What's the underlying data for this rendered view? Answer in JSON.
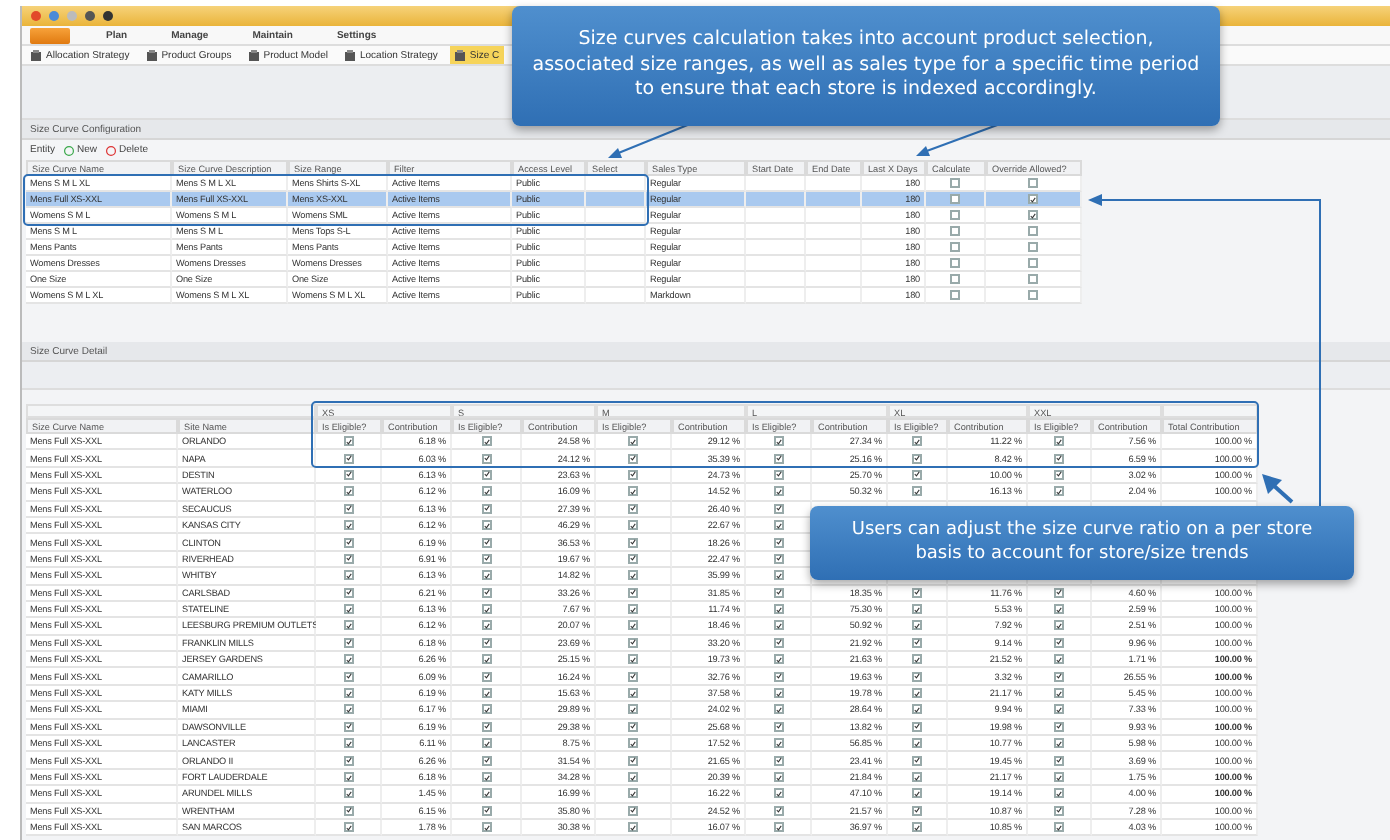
{
  "ribbon": {
    "tabs": [
      "Plan",
      "Manage",
      "Maintain",
      "Settings"
    ]
  },
  "toolbar": [
    {
      "label": "Allocation Strategy",
      "selected": false
    },
    {
      "label": "Product Groups",
      "selected": false
    },
    {
      "label": "Product Model",
      "selected": false
    },
    {
      "label": "Location Strategy",
      "selected": false
    },
    {
      "label": "Size C",
      "selected": true
    }
  ],
  "configuration": {
    "title": "Size Curve Configuration",
    "entity_label": "Entity",
    "actions": [
      {
        "kind": "new",
        "label": "New"
      },
      {
        "kind": "delete",
        "label": "Delete"
      }
    ],
    "columns": [
      "Size Curve Name",
      "Size Curve Description",
      "Size Range",
      "Filter",
      "Access Level",
      "Select",
      "Sales Type",
      "Start Date",
      "End Date",
      "Last X Days",
      "Calculate",
      "Override Allowed?"
    ],
    "rows": [
      {
        "name": "Mens S M L XL",
        "description": "Mens S M L XL",
        "size_range": "Mens Shirts S-XL",
        "filter": "Active Items",
        "access_level": "Public",
        "sales_type": "Regular",
        "last_x_days": "180",
        "calculate": false,
        "override_allowed": false,
        "selected": false
      },
      {
        "name": "Mens Full XS-XXL",
        "description": "Mens Full XS-XXL",
        "size_range": "Mens XS-XXL",
        "filter": "Active Items",
        "access_level": "Public",
        "sales_type": "Regular",
        "last_x_days": "180",
        "calculate": false,
        "override_allowed": true,
        "selected": true
      },
      {
        "name": "Womens S M L",
        "description": "Womens S M L",
        "size_range": "Womens SML",
        "filter": "Active Items",
        "access_level": "Public",
        "sales_type": "Regular",
        "last_x_days": "180",
        "calculate": false,
        "override_allowed": true,
        "selected": false
      },
      {
        "name": "Mens S M L",
        "description": "Mens S M L",
        "size_range": "Mens Tops S-L",
        "filter": "Active Items",
        "access_level": "Public",
        "sales_type": "Regular",
        "last_x_days": "180",
        "calculate": false,
        "override_allowed": false,
        "selected": false
      },
      {
        "name": "Mens Pants",
        "description": "Mens Pants",
        "size_range": "Mens Pants",
        "filter": "Active Items",
        "access_level": "Public",
        "sales_type": "Regular",
        "last_x_days": "180",
        "calculate": false,
        "override_allowed": false,
        "selected": false
      },
      {
        "name": "Womens Dresses",
        "description": "Womens Dresses",
        "size_range": "Womens Dresses",
        "filter": "Active Items",
        "access_level": "Public",
        "sales_type": "Regular",
        "last_x_days": "180",
        "calculate": false,
        "override_allowed": false,
        "selected": false
      },
      {
        "name": "One Size",
        "description": "One Size",
        "size_range": "One Size",
        "filter": "Active Items",
        "access_level": "Public",
        "sales_type": "Regular",
        "last_x_days": "180",
        "calculate": false,
        "override_allowed": false,
        "selected": false
      },
      {
        "name": "Womens S M L XL",
        "description": "Womens S M L XL",
        "size_range": "Womens S M L XL",
        "filter": "Active Items",
        "access_level": "Public",
        "sales_type": "Markdown",
        "last_x_days": "180",
        "calculate": false,
        "override_allowed": false,
        "selected": false
      }
    ]
  },
  "detail": {
    "title": "Size Curve Detail",
    "size_groups": [
      {
        "label": "XS",
        "eligible": "Is Eligible?",
        "contribution": "Contribution"
      },
      {
        "label": "S",
        "eligible": "Is Eligible?",
        "contribution": "Contribution"
      },
      {
        "label": "M",
        "eligible": "Is Eligible?",
        "contribution": "Contribution"
      },
      {
        "label": "L",
        "eligible": "Is Eligible?",
        "contribution": "Contribution"
      },
      {
        "label": "XL",
        "eligible": "Is Eligible?",
        "contribution": "Contribution"
      },
      {
        "label": "XXL",
        "eligible": "Is Eligible?",
        "contribution": "Contribution"
      }
    ],
    "columns": {
      "name": "Size Curve Name",
      "site": "Site Name",
      "total": "Total Contribution"
    },
    "rows": [
      {
        "name": "Mens Full XS-XXL",
        "site": "ORLANDO",
        "sizes": [
          {
            "eligible": true,
            "contribution": "6.18 %"
          },
          {
            "eligible": true,
            "contribution": "24.58 %"
          },
          {
            "eligible": true,
            "contribution": "29.12 %"
          },
          {
            "eligible": true,
            "contribution": "27.34 %"
          },
          {
            "eligible": true,
            "contribution": "11.22 %"
          },
          {
            "eligible": true,
            "contribution": "7.56 %"
          }
        ],
        "total": "100.00 %",
        "total_bold": false
      },
      {
        "name": "Mens Full XS-XXL",
        "site": "NAPA",
        "sizes": [
          {
            "eligible": true,
            "contribution": "6.03 %"
          },
          {
            "eligible": true,
            "contribution": "24.12 %"
          },
          {
            "eligible": true,
            "contribution": "35.39 %"
          },
          {
            "eligible": true,
            "contribution": "25.16 %"
          },
          {
            "eligible": true,
            "contribution": "8.42 %"
          },
          {
            "eligible": true,
            "contribution": "6.59 %"
          }
        ],
        "total": "100.00 %",
        "total_bold": false
      },
      {
        "name": "Mens Full XS-XXL",
        "site": "DESTIN",
        "sizes": [
          {
            "eligible": true,
            "contribution": "6.13 %"
          },
          {
            "eligible": true,
            "contribution": "23.63 %"
          },
          {
            "eligible": true,
            "contribution": "24.73 %"
          },
          {
            "eligible": true,
            "contribution": "25.70 %"
          },
          {
            "eligible": true,
            "contribution": "10.00 %"
          },
          {
            "eligible": true,
            "contribution": "3.02 %"
          }
        ],
        "total": "100.00 %",
        "total_bold": false
      },
      {
        "name": "Mens Full XS-XXL",
        "site": "WATERLOO",
        "sizes": [
          {
            "eligible": true,
            "contribution": "6.12 %"
          },
          {
            "eligible": true,
            "contribution": "16.09 %"
          },
          {
            "eligible": true,
            "contribution": "14.52 %"
          },
          {
            "eligible": true,
            "contribution": "50.32 %"
          },
          {
            "eligible": true,
            "contribution": "16.13 %"
          },
          {
            "eligible": true,
            "contribution": "2.04 %"
          }
        ],
        "total": "100.00 %",
        "total_bold": false
      },
      {
        "name": "Mens Full XS-XXL",
        "site": "SECAUCUS",
        "sizes": [
          {
            "eligible": true,
            "contribution": "6.13 %"
          },
          {
            "eligible": true,
            "contribution": "27.39 %"
          },
          {
            "eligible": true,
            "contribution": "26.40 %"
          },
          {
            "eligible": true
          }
        ]
      },
      {
        "name": "Mens Full XS-XXL",
        "site": "KANSAS CITY",
        "sizes": [
          {
            "eligible": true,
            "contribution": "6.12 %"
          },
          {
            "eligible": true,
            "contribution": "46.29 %"
          },
          {
            "eligible": true,
            "contribution": "22.67 %"
          },
          {
            "eligible": true
          }
        ]
      },
      {
        "name": "Mens Full XS-XXL",
        "site": "CLINTON",
        "sizes": [
          {
            "eligible": true,
            "contribution": "6.19 %"
          },
          {
            "eligible": true,
            "contribution": "36.53 %"
          },
          {
            "eligible": true,
            "contribution": "18.26 %"
          },
          {
            "eligible": true
          }
        ]
      },
      {
        "name": "Mens Full XS-XXL",
        "site": "RIVERHEAD",
        "sizes": [
          {
            "eligible": true,
            "contribution": "6.91 %"
          },
          {
            "eligible": true,
            "contribution": "19.67 %"
          },
          {
            "eligible": true,
            "contribution": "22.47 %"
          },
          {
            "eligible": true
          }
        ]
      },
      {
        "name": "Mens Full XS-XXL",
        "site": "WHITBY",
        "sizes": [
          {
            "eligible": true,
            "contribution": "6.13 %"
          },
          {
            "eligible": true,
            "contribution": "14.82 %"
          },
          {
            "eligible": true,
            "contribution": "35.99 %"
          },
          {
            "eligible": true
          }
        ]
      },
      {
        "name": "Mens Full XS-XXL",
        "site": "CARLSBAD",
        "sizes": [
          {
            "eligible": true,
            "contribution": "6.21 %"
          },
          {
            "eligible": true,
            "contribution": "33.26 %"
          },
          {
            "eligible": true,
            "contribution": "31.85 %"
          },
          {
            "eligible": true,
            "contribution": "18.35 %"
          },
          {
            "eligible": true,
            "contribution": "11.76 %"
          },
          {
            "eligible": true,
            "contribution": "4.60 %"
          }
        ],
        "total": "100.00 %",
        "total_bold": false
      },
      {
        "name": "Mens Full XS-XXL",
        "site": "STATELINE",
        "sizes": [
          {
            "eligible": true,
            "contribution": "6.13 %"
          },
          {
            "eligible": true,
            "contribution": "7.67 %"
          },
          {
            "eligible": true,
            "contribution": "11.74 %"
          },
          {
            "eligible": true,
            "contribution": "75.30 %"
          },
          {
            "eligible": true,
            "contribution": "5.53 %"
          },
          {
            "eligible": true,
            "contribution": "2.59 %"
          }
        ],
        "total": "100.00 %",
        "total_bold": false
      },
      {
        "name": "Mens Full XS-XXL",
        "site": "LEESBURG PREMIUM OUTLETS",
        "sizes": [
          {
            "eligible": true,
            "contribution": "6.12 %"
          },
          {
            "eligible": true,
            "contribution": "20.07 %"
          },
          {
            "eligible": true,
            "contribution": "18.46 %"
          },
          {
            "eligible": true,
            "contribution": "50.92 %"
          },
          {
            "eligible": true,
            "contribution": "7.92 %"
          },
          {
            "eligible": true,
            "contribution": "2.51 %"
          }
        ],
        "total": "100.00 %",
        "total_bold": false
      },
      {
        "name": "Mens Full XS-XXL",
        "site": "FRANKLIN MILLS",
        "sizes": [
          {
            "eligible": true,
            "contribution": "6.18 %"
          },
          {
            "eligible": true,
            "contribution": "23.69 %"
          },
          {
            "eligible": true,
            "contribution": "33.20 %"
          },
          {
            "eligible": true,
            "contribution": "21.92 %"
          },
          {
            "eligible": true,
            "contribution": "9.14 %"
          },
          {
            "eligible": true,
            "contribution": "9.96 %"
          }
        ],
        "total": "100.00 %",
        "total_bold": false
      },
      {
        "name": "Mens Full XS-XXL",
        "site": "JERSEY GARDENS",
        "sizes": [
          {
            "eligible": true,
            "contribution": "6.26 %"
          },
          {
            "eligible": true,
            "contribution": "25.15 %"
          },
          {
            "eligible": true,
            "contribution": "19.73 %"
          },
          {
            "eligible": true,
            "contribution": "21.63 %"
          },
          {
            "eligible": true,
            "contribution": "21.52 %"
          },
          {
            "eligible": true,
            "contribution": "1.71 %"
          }
        ],
        "total": "100.00 %",
        "total_bold": true
      },
      {
        "name": "Mens Full XS-XXL",
        "site": "CAMARILLO",
        "sizes": [
          {
            "eligible": true,
            "contribution": "6.09 %"
          },
          {
            "eligible": true,
            "contribution": "16.24 %"
          },
          {
            "eligible": true,
            "contribution": "32.76 %"
          },
          {
            "eligible": true,
            "contribution": "19.63 %"
          },
          {
            "eligible": true,
            "contribution": "3.32 %"
          },
          {
            "eligible": true,
            "contribution": "26.55 %"
          }
        ],
        "total": "100.00 %",
        "total_bold": true
      },
      {
        "name": "Mens Full XS-XXL",
        "site": "KATY MILLS",
        "sizes": [
          {
            "eligible": true,
            "contribution": "6.19 %"
          },
          {
            "eligible": true,
            "contribution": "15.63 %"
          },
          {
            "eligible": true,
            "contribution": "37.58 %"
          },
          {
            "eligible": true,
            "contribution": "19.78 %"
          },
          {
            "eligible": true,
            "contribution": "21.17 %"
          },
          {
            "eligible": true,
            "contribution": "5.45 %"
          }
        ],
        "total": "100.00 %",
        "total_bold": false
      },
      {
        "name": "Mens Full XS-XXL",
        "site": "MIAMI",
        "sizes": [
          {
            "eligible": true,
            "contribution": "6.17 %"
          },
          {
            "eligible": true,
            "contribution": "29.89 %"
          },
          {
            "eligible": true,
            "contribution": "24.02 %"
          },
          {
            "eligible": true,
            "contribution": "28.64 %"
          },
          {
            "eligible": true,
            "contribution": "9.94 %"
          },
          {
            "eligible": true,
            "contribution": "7.33 %"
          }
        ],
        "total": "100.00 %",
        "total_bold": false
      },
      {
        "name": "Mens Full XS-XXL",
        "site": "DAWSONVILLE",
        "sizes": [
          {
            "eligible": true,
            "contribution": "6.19 %"
          },
          {
            "eligible": true,
            "contribution": "29.38 %"
          },
          {
            "eligible": true,
            "contribution": "25.68 %"
          },
          {
            "eligible": true,
            "contribution": "13.82 %"
          },
          {
            "eligible": true,
            "contribution": "19.98 %"
          },
          {
            "eligible": true,
            "contribution": "9.93 %"
          }
        ],
        "total": "100.00 %",
        "total_bold": true
      },
      {
        "name": "Mens Full XS-XXL",
        "site": "LANCASTER",
        "sizes": [
          {
            "eligible": true,
            "contribution": "6.11 %"
          },
          {
            "eligible": true,
            "contribution": "8.75 %"
          },
          {
            "eligible": true,
            "contribution": "17.52 %"
          },
          {
            "eligible": true,
            "contribution": "56.85 %"
          },
          {
            "eligible": true,
            "contribution": "10.77 %"
          },
          {
            "eligible": true,
            "contribution": "5.98 %"
          }
        ],
        "total": "100.00 %",
        "total_bold": false
      },
      {
        "name": "Mens Full XS-XXL",
        "site": "ORLANDO II",
        "sizes": [
          {
            "eligible": true,
            "contribution": "6.26 %"
          },
          {
            "eligible": true,
            "contribution": "31.54 %"
          },
          {
            "eligible": true,
            "contribution": "21.65 %"
          },
          {
            "eligible": true,
            "contribution": "23.41 %"
          },
          {
            "eligible": true,
            "contribution": "19.45 %"
          },
          {
            "eligible": true,
            "contribution": "3.69 %"
          }
        ],
        "total": "100.00 %",
        "total_bold": false
      },
      {
        "name": "Mens Full XS-XXL",
        "site": "FORT LAUDERDALE",
        "sizes": [
          {
            "eligible": true,
            "contribution": "6.18 %"
          },
          {
            "eligible": true,
            "contribution": "34.28 %"
          },
          {
            "eligible": true,
            "contribution": "20.39 %"
          },
          {
            "eligible": true,
            "contribution": "21.84 %"
          },
          {
            "eligible": true,
            "contribution": "21.17 %"
          },
          {
            "eligible": true,
            "contribution": "1.75 %"
          }
        ],
        "total": "100.00 %",
        "total_bold": true
      },
      {
        "name": "Mens Full XS-XXL",
        "site": "ARUNDEL MILLS",
        "sizes": [
          {
            "eligible": true,
            "contribution": "1.45 %"
          },
          {
            "eligible": true,
            "contribution": "16.99 %"
          },
          {
            "eligible": true,
            "contribution": "16.22 %"
          },
          {
            "eligible": true,
            "contribution": "47.10 %"
          },
          {
            "eligible": true,
            "contribution": "19.14 %"
          },
          {
            "eligible": true,
            "contribution": "4.00 %"
          }
        ],
        "total": "100.00 %",
        "total_bold": true
      },
      {
        "name": "Mens Full XS-XXL",
        "site": "WRENTHAM",
        "sizes": [
          {
            "eligible": true,
            "contribution": "6.15 %"
          },
          {
            "eligible": true,
            "contribution": "35.80 %"
          },
          {
            "eligible": true,
            "contribution": "24.52 %"
          },
          {
            "eligible": true,
            "contribution": "21.57 %"
          },
          {
            "eligible": true,
            "contribution": "10.87 %"
          },
          {
            "eligible": true,
            "contribution": "7.28 %"
          }
        ],
        "total": "100.00 %",
        "total_bold": false
      },
      {
        "name": "Mens Full XS-XXL",
        "site": "SAN MARCOS",
        "sizes": [
          {
            "eligible": true,
            "contribution": "1.78 %"
          },
          {
            "eligible": true,
            "contribution": "30.38 %"
          },
          {
            "eligible": true,
            "contribution": "16.07 %"
          },
          {
            "eligible": true,
            "contribution": "36.97 %"
          },
          {
            "eligible": true,
            "contribution": "10.85 %"
          },
          {
            "eligible": true,
            "contribution": "4.03 %"
          }
        ],
        "total": "100.00 %",
        "total_bold": false
      }
    ]
  },
  "callouts": [
    "Size curves calculation takes into account product selection, associated size ranges, as well as sales type for a specific time period to ensure that each store is indexed accordingly.",
    "Users can adjust the size curve ratio on a per store basis to account for store/size trends"
  ]
}
